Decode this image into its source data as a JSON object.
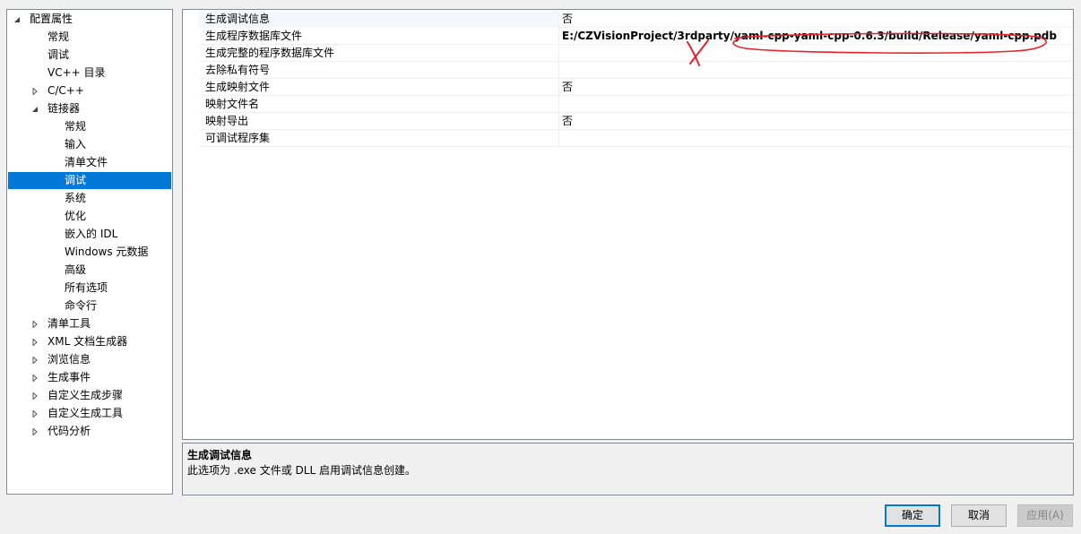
{
  "tree": {
    "items": [
      {
        "label": "配置属性",
        "arrow": "expanded",
        "level": 0
      },
      {
        "label": "常规",
        "arrow": "none",
        "level": 1
      },
      {
        "label": "调试",
        "arrow": "none",
        "level": 1
      },
      {
        "label": "VC++ 目录",
        "arrow": "none",
        "level": 1
      },
      {
        "label": "C/C++",
        "arrow": "collapsed",
        "level": 1
      },
      {
        "label": "链接器",
        "arrow": "expanded",
        "level": 1
      },
      {
        "label": "常规",
        "arrow": "none",
        "level": 2
      },
      {
        "label": "输入",
        "arrow": "none",
        "level": 2
      },
      {
        "label": "清单文件",
        "arrow": "none",
        "level": 2
      },
      {
        "label": "调试",
        "arrow": "none",
        "level": 2,
        "selected": true
      },
      {
        "label": "系统",
        "arrow": "none",
        "level": 2
      },
      {
        "label": "优化",
        "arrow": "none",
        "level": 2
      },
      {
        "label": "嵌入的 IDL",
        "arrow": "none",
        "level": 2
      },
      {
        "label": "Windows 元数据",
        "arrow": "none",
        "level": 2
      },
      {
        "label": "高级",
        "arrow": "none",
        "level": 2
      },
      {
        "label": "所有选项",
        "arrow": "none",
        "level": 2
      },
      {
        "label": "命令行",
        "arrow": "none",
        "level": 2
      },
      {
        "label": "清单工具",
        "arrow": "collapsed",
        "level": 1
      },
      {
        "label": "XML 文档生成器",
        "arrow": "collapsed",
        "level": 1
      },
      {
        "label": "浏览信息",
        "arrow": "collapsed",
        "level": 1
      },
      {
        "label": "生成事件",
        "arrow": "collapsed",
        "level": 1
      },
      {
        "label": "自定义生成步骤",
        "arrow": "collapsed",
        "level": 1
      },
      {
        "label": "自定义生成工具",
        "arrow": "collapsed",
        "level": 1
      },
      {
        "label": "代码分析",
        "arrow": "collapsed",
        "level": 1
      }
    ]
  },
  "grid": {
    "rows": [
      {
        "name": "生成调试信息",
        "value": "否",
        "bold": false
      },
      {
        "name": "生成程序数据库文件",
        "value": "E:/CZVisionProject/3rdparty/yaml-cpp-yaml-cpp-0.6.3/build/Release/yaml-cpp.pdb",
        "bold": true
      },
      {
        "name": "生成完整的程序数据库文件",
        "value": "",
        "bold": false
      },
      {
        "name": "去除私有符号",
        "value": "",
        "bold": false
      },
      {
        "name": "生成映射文件",
        "value": "否",
        "bold": false
      },
      {
        "name": "映射文件名",
        "value": "",
        "bold": false
      },
      {
        "name": "映射导出",
        "value": "否",
        "bold": false
      },
      {
        "name": "可调试程序集",
        "value": "",
        "bold": false
      }
    ]
  },
  "description": {
    "title": "生成调试信息",
    "text": "此选项为 .exe 文件或 DLL 启用调试信息创建。"
  },
  "buttons": {
    "ok": "确定",
    "cancel": "取消",
    "apply": "应用(A)"
  },
  "colors": {
    "selection": "#0078d7",
    "annotation": "#e8202a"
  }
}
